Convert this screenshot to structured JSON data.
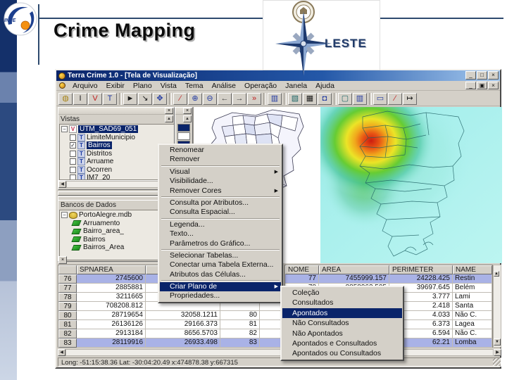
{
  "slide": {
    "title": "Crime Mapping",
    "logo_label": "INPE",
    "brand_label": "LESTE"
  },
  "window": {
    "title": "Terra Crime 1.0 - [Tela de Visualização]",
    "menus": [
      "Arquivo",
      "Exibir",
      "Plano",
      "Vista",
      "Tema",
      "Análise",
      "Operação",
      "Janela",
      "Ajuda"
    ]
  },
  "icons": {
    "close": "×",
    "minimize": "_",
    "maximize": "□",
    "restore": "▣",
    "check": "✓",
    "submenu_arrow": "▶",
    "scroll_up": "▲",
    "scroll_down": "▼",
    "scroll_left": "◀",
    "scroll_right": "▶",
    "expand_minus": "−",
    "view_letter": "V",
    "theme_letter": "T"
  },
  "toolbar": {
    "buttons": [
      {
        "name": "database",
        "glyph": "◍"
      },
      {
        "name": "text-i",
        "glyph": "I"
      },
      {
        "name": "view-v",
        "glyph": "V"
      },
      {
        "name": "theme-t",
        "glyph": "T"
      },
      {
        "name": "pointer",
        "glyph": "►"
      },
      {
        "name": "select-corner",
        "glyph": "↘"
      },
      {
        "name": "pan",
        "glyph": "✥"
      },
      {
        "name": "distance",
        "glyph": "∕"
      },
      {
        "name": "zoom-in",
        "glyph": "⊕"
      },
      {
        "name": "zoom-out",
        "glyph": "⊖"
      },
      {
        "name": "previous",
        "glyph": "←"
      },
      {
        "name": "next",
        "glyph": "→"
      },
      {
        "name": "fly",
        "glyph": "»"
      },
      {
        "name": "tile-windows",
        "glyph": "▥"
      },
      {
        "name": "chart",
        "glyph": "▧"
      },
      {
        "name": "table",
        "glyph": "▦"
      },
      {
        "name": "info-balloon",
        "glyph": "◘"
      },
      {
        "name": "display",
        "glyph": "▢"
      },
      {
        "name": "bar-graph",
        "glyph": "▥"
      },
      {
        "name": "screen",
        "glyph": "▭"
      },
      {
        "name": "draw-line",
        "glyph": "∕"
      },
      {
        "name": "measure",
        "glyph": "↦"
      }
    ]
  },
  "vistas_panel": {
    "title": "Vistas",
    "root_label": "UTM_SAD69_051",
    "themes": [
      {
        "label": "LimiteMunicipio"
      },
      {
        "label": "Bairros"
      },
      {
        "label": "Distritos"
      },
      {
        "label": "Arruame"
      },
      {
        "label": "Ocorren"
      },
      {
        "label": "IM7_20"
      }
    ]
  },
  "databases_panel": {
    "title": "Bancos de Dados",
    "root_label": "PortoAlegre.mdb",
    "layers": [
      "Arruamento",
      "Bairro_area_",
      "Bairros",
      "Bairros_Area"
    ]
  },
  "context_menu": {
    "items": [
      {
        "label": "Renomear"
      },
      {
        "label": "Remover"
      },
      {
        "label": "Visual"
      },
      {
        "label": "Visibilidade..."
      },
      {
        "label": "Remover Cores"
      },
      {
        "label": "Consulta por Atributos..."
      },
      {
        "label": "Consulta Espacial..."
      },
      {
        "label": "Legenda..."
      },
      {
        "label": "Texto..."
      },
      {
        "label": "Parâmetros do Gráfico..."
      },
      {
        "label": "Selecionar Tabelas..."
      },
      {
        "label": "Conectar uma Tabela Externa..."
      },
      {
        "label": "Atributos das Células..."
      },
      {
        "label": "Criar Plano de"
      },
      {
        "label": "Propriedades..."
      }
    ]
  },
  "submenu": {
    "items": [
      {
        "label": "Coleção"
      },
      {
        "label": "Consultados"
      },
      {
        "label": "Apontados"
      },
      {
        "label": "Não Consultados"
      },
      {
        "label": "Não Apontados"
      },
      {
        "label": "Apontados e Consultados"
      },
      {
        "label": "Apontados ou Consultados"
      }
    ]
  },
  "attr_table_left": {
    "headers": [
      "",
      "SPNAREA",
      "",
      ""
    ],
    "rows": [
      [
        "76",
        "2745600",
        "",
        ""
      ],
      [
        "77",
        "2885881",
        "",
        ""
      ],
      [
        "78",
        "3211665",
        "",
        ""
      ],
      [
        "79",
        "708208.812",
        "",
        ""
      ],
      [
        "80",
        "28719654",
        "32058.1211",
        "80"
      ],
      [
        "81",
        "26136126",
        "29166.373",
        "81"
      ],
      [
        "82",
        "2913184",
        "8656.5703",
        "82"
      ],
      [
        "83",
        "28119916",
        "26933.498",
        "83"
      ]
    ]
  },
  "attr_table_right": {
    "headers": [
      "NOME",
      "AREA",
      "PERIMETER",
      "NAME"
    ],
    "rows": [
      [
        "77",
        "7455999.157",
        "24228.425",
        "Restin"
      ],
      [
        "78",
        "8858963.505",
        "39697.645",
        "Belém"
      ],
      [
        "",
        "",
        "3.777",
        "Lami"
      ],
      [
        "",
        "",
        "2.418",
        "Santa"
      ],
      [
        "",
        "",
        "4.033",
        "Não C."
      ],
      [
        "",
        "",
        "6.373",
        "Lagea"
      ],
      [
        "",
        "",
        "6.594",
        "Não C."
      ],
      [
        "",
        "",
        "62.21",
        "Lomba"
      ]
    ]
  },
  "status_bar": {
    "text": "Long: -51:15:38.36 Lat: -30:04:20.49  x:474878.38  y:667315"
  },
  "colors": {
    "titlebar_left": "#0a246a",
    "titlebar_right": "#a6caf0",
    "selection": "#0a246a",
    "chrome": "#d4d0c8",
    "row_highlight": "#a9b2e6"
  }
}
